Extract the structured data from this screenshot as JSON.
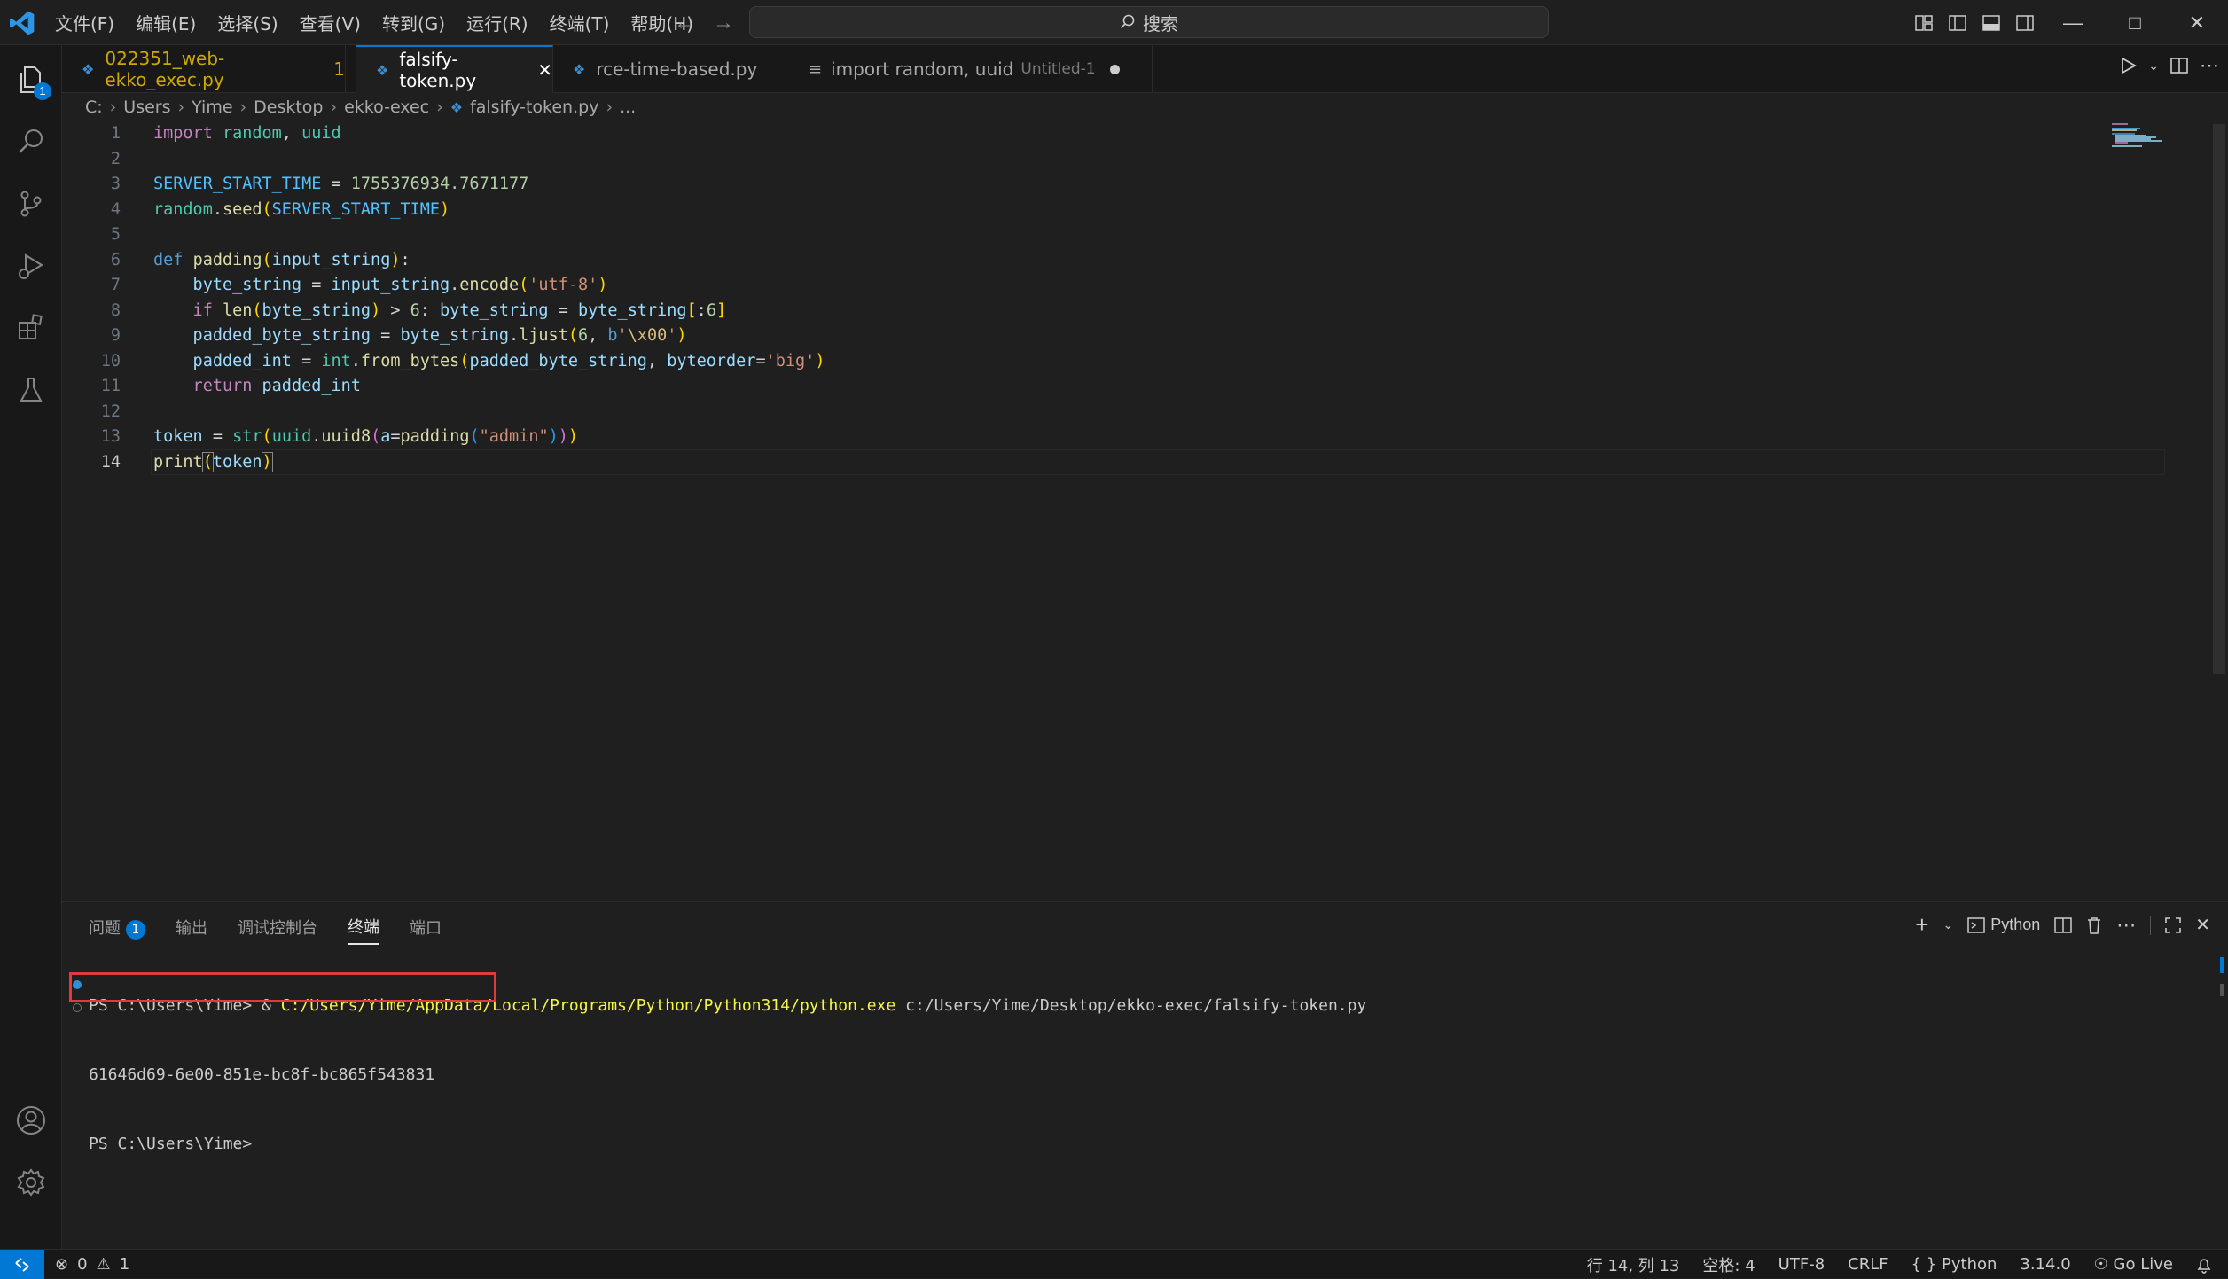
{
  "menu": [
    "文件(F)",
    "编辑(E)",
    "选择(S)",
    "查看(V)",
    "转到(G)",
    "运行(R)",
    "终端(T)",
    "帮助(H)"
  ],
  "search": {
    "placeholder": "搜索"
  },
  "activity": {
    "explorer_badge": "1"
  },
  "tabs": [
    {
      "label": "022351_web-ekko_exec.py",
      "suffix": "1",
      "color": "#cca700"
    },
    {
      "label": "falsify-token.py",
      "active": true
    },
    {
      "label": "rce-time-based.py"
    },
    {
      "label": "import random, uuid",
      "detail": "Untitled-1",
      "dirty": true
    }
  ],
  "breadcrumb": [
    "C:",
    "Users",
    "Yime",
    "Desktop",
    "ekko-exec",
    "falsify-token.py",
    "..."
  ],
  "code": {
    "line_numbers": [
      "1",
      "2",
      "3",
      "4",
      "5",
      "6",
      "7",
      "8",
      "9",
      "10",
      "11",
      "12",
      "13",
      "14"
    ],
    "current_line": "14"
  },
  "panel": {
    "tabs": [
      {
        "label": "问题",
        "badge": "1"
      },
      {
        "label": "输出"
      },
      {
        "label": "调试控制台"
      },
      {
        "label": "终端",
        "active": true
      },
      {
        "label": "端口"
      }
    ],
    "shell_label": "Python",
    "terminal": {
      "prompt1": "PS C:\\Users\\Yime> & ",
      "exe_path": "C:/Users/Yime/AppData/Local/Programs/Python/Python314/python.exe",
      "script_arg": " c:/Users/Yime/Desktop/ekko-exec/falsify-token.py",
      "output": "61646d69-6e00-851e-bc8f-bc865f543831",
      "prompt2": "PS C:\\Users\\Yime>"
    }
  },
  "status": {
    "errors": "0",
    "warnings": "1",
    "position": "行 14, 列 13",
    "spaces": "空格: 4",
    "encoding": "UTF-8",
    "eol": "CRLF",
    "language": "Python",
    "version": "3.14.0",
    "golive": "Go Live"
  },
  "colors": {
    "accent": "#0078d4",
    "highlight_box": "#e0393e"
  }
}
